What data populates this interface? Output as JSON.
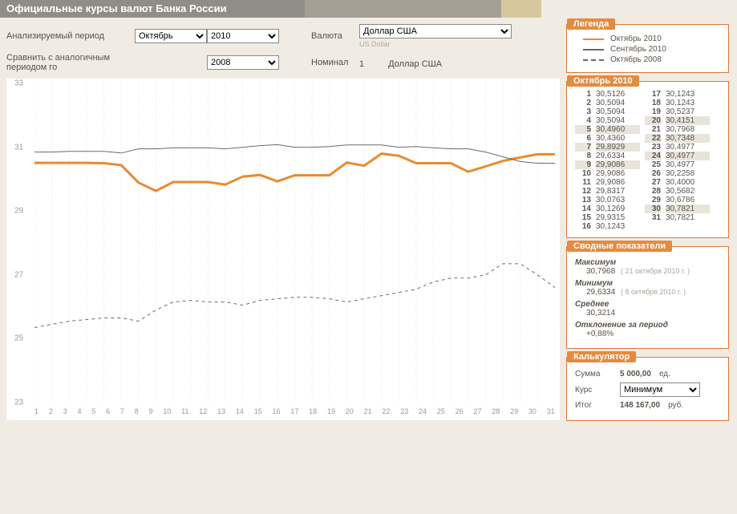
{
  "title": "Официальные курсы валют Банка России",
  "filters": {
    "period_label": "Анализируемый период",
    "month_selected": "Октябрь",
    "year_selected": "2010",
    "compare_label": "Сравнить с аналогичным периодом го",
    "compare_year_selected": "2008",
    "currency_label": "Валюта",
    "currency_selected": "Доллар США",
    "currency_sub": "US Dollar",
    "nominal_label": "Номинал",
    "nominal_value": "1",
    "nominal_unit": "Доллар США"
  },
  "legend": {
    "title": "Легенда",
    "items": [
      {
        "label": "Октябрь 2010",
        "style": "oct"
      },
      {
        "label": "Сентябрь 2010",
        "style": "sep"
      },
      {
        "label": "Октябрь 2008",
        "style": "dash"
      }
    ]
  },
  "rates_panel_title": "Октябрь 2010",
  "rates": [
    {
      "d": 1,
      "v": "30,5126"
    },
    {
      "d": 2,
      "v": "30,5094"
    },
    {
      "d": 3,
      "v": "30,5094"
    },
    {
      "d": 4,
      "v": "30,5094"
    },
    {
      "d": 5,
      "v": "30,4960"
    },
    {
      "d": 6,
      "v": "30,4360"
    },
    {
      "d": 7,
      "v": "29,8929"
    },
    {
      "d": 8,
      "v": "29,6334"
    },
    {
      "d": 9,
      "v": "29,9086"
    },
    {
      "d": 10,
      "v": "29,9086"
    },
    {
      "d": 11,
      "v": "29,9086"
    },
    {
      "d": 12,
      "v": "29,8317"
    },
    {
      "d": 13,
      "v": "30,0763"
    },
    {
      "d": 14,
      "v": "30,1269"
    },
    {
      "d": 15,
      "v": "29,9315"
    },
    {
      "d": 16,
      "v": "30,1243"
    },
    {
      "d": 17,
      "v": "30,1243"
    },
    {
      "d": 18,
      "v": "30,1243"
    },
    {
      "d": 19,
      "v": "30,5237"
    },
    {
      "d": 20,
      "v": "30,4151"
    },
    {
      "d": 21,
      "v": "30,7968"
    },
    {
      "d": 22,
      "v": "30,7348"
    },
    {
      "d": 23,
      "v": "30,4977"
    },
    {
      "d": 24,
      "v": "30,4977"
    },
    {
      "d": 25,
      "v": "30,4977"
    },
    {
      "d": 26,
      "v": "30,2258"
    },
    {
      "d": 27,
      "v": "30,4000"
    },
    {
      "d": 28,
      "v": "30,5682"
    },
    {
      "d": 29,
      "v": "30,6786"
    },
    {
      "d": 30,
      "v": "30,7821"
    },
    {
      "d": 31,
      "v": "30,7821"
    }
  ],
  "rates_hl_days": [
    5,
    7,
    9,
    20,
    22,
    24,
    30
  ],
  "summary": {
    "title": "Сводные показатели",
    "max_label": "Максимум",
    "max_value": "30,7968",
    "max_note": "( 21 октября 2010 г. )",
    "min_label": "Минимум",
    "min_value": "29,6334",
    "min_note": "( 8 октября 2010 г. )",
    "avg_label": "Среднее",
    "avg_value": "30,3214",
    "dev_label": "Отклонение за период",
    "dev_value": "+0,88%"
  },
  "calc": {
    "title": "Калькулятор",
    "sum_label": "Сумма",
    "sum_value": "5 000,00",
    "sum_unit": "ед.",
    "rate_label": "Курс",
    "rate_selected": "Минимум",
    "total_label": "Итог",
    "total_value": "148 167,00",
    "total_unit": "руб."
  },
  "chart_data": {
    "type": "line",
    "x": [
      1,
      2,
      3,
      4,
      5,
      6,
      7,
      8,
      9,
      10,
      11,
      12,
      13,
      14,
      15,
      16,
      17,
      18,
      19,
      20,
      21,
      22,
      23,
      24,
      25,
      26,
      27,
      28,
      29,
      30,
      31
    ],
    "xlabel": "",
    "ylabel": "",
    "ylim": [
      23,
      33
    ],
    "yticks": [
      23,
      25,
      27,
      29,
      31,
      33
    ],
    "series": [
      {
        "name": "Октябрь 2010",
        "color": "#e98a2e",
        "width": 3,
        "dash": "",
        "values": [
          30.51,
          30.51,
          30.51,
          30.51,
          30.5,
          30.44,
          29.89,
          29.63,
          29.91,
          29.91,
          29.91,
          29.83,
          30.08,
          30.13,
          29.93,
          30.12,
          30.12,
          30.12,
          30.52,
          30.42,
          30.8,
          30.73,
          30.5,
          30.5,
          30.5,
          30.23,
          30.4,
          30.57,
          30.68,
          30.78,
          30.78
        ]
      },
      {
        "name": "Сентябрь 2010",
        "color": "#6a6a6a",
        "width": 1,
        "dash": "",
        "values": [
          30.85,
          30.85,
          30.87,
          30.87,
          30.87,
          30.82,
          30.95,
          30.95,
          30.98,
          30.98,
          30.98,
          30.95,
          31.0,
          31.05,
          31.08,
          31.0,
          31.0,
          31.02,
          31.07,
          31.07,
          31.07,
          31.0,
          31.02,
          30.98,
          30.95,
          30.95,
          30.85,
          30.7,
          30.55,
          30.5,
          30.5
        ]
      },
      {
        "name": "Октябрь 2008",
        "color": "#6a6a6a",
        "width": 1,
        "dash": "4 4",
        "values": [
          25.35,
          25.45,
          25.55,
          25.6,
          25.65,
          25.65,
          25.55,
          25.9,
          26.15,
          26.2,
          26.15,
          26.15,
          26.05,
          26.2,
          26.25,
          26.3,
          26.3,
          26.25,
          26.15,
          26.25,
          26.35,
          26.45,
          26.55,
          26.78,
          26.9,
          26.9,
          27.0,
          27.35,
          27.35,
          27.0,
          26.6
        ]
      }
    ]
  }
}
